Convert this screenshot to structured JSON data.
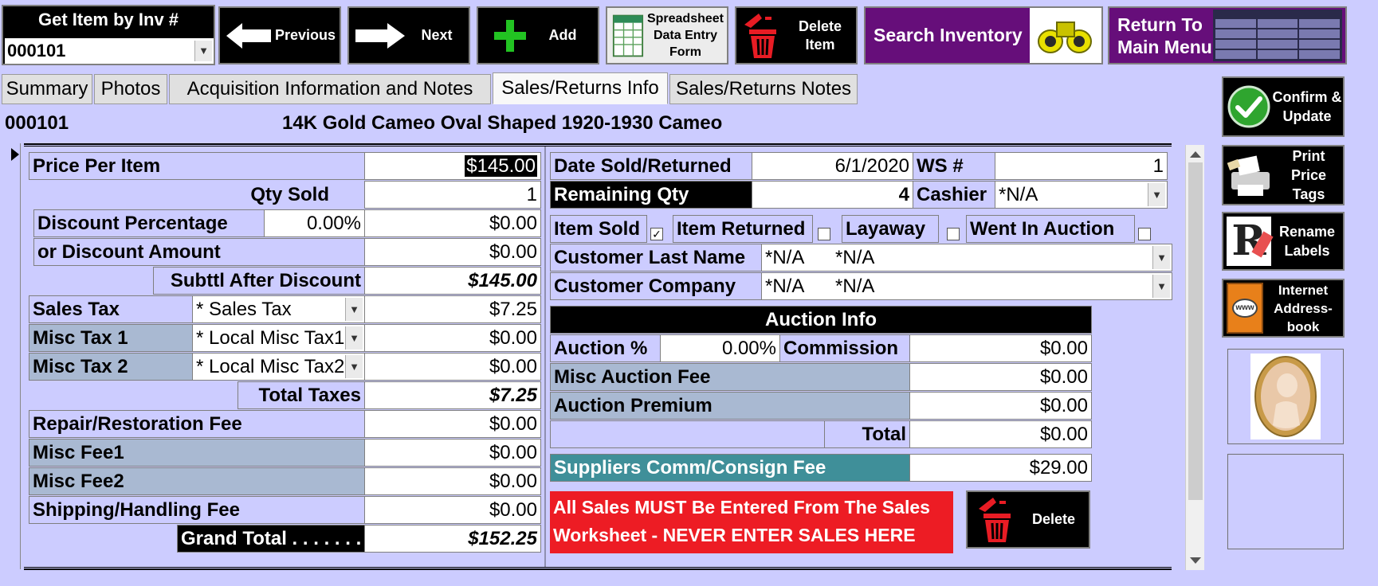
{
  "toolbar": {
    "get_item_label": "Get Item by Inv #",
    "inv_number": "000101",
    "previous": "Previous",
    "next": "Next",
    "add": "Add",
    "spreadsheet": "Spreadsheet Data Entry Form",
    "delete_item": "Delete Item",
    "search_inventory": "Search Inventory",
    "return_main": "Return To Main Menu"
  },
  "tabs": [
    {
      "label": "Summary"
    },
    {
      "label": "Photos"
    },
    {
      "label": "Acquisition Information and Notes"
    },
    {
      "label": "Sales/Returns Info",
      "active": true
    },
    {
      "label": "Sales/Returns Notes"
    }
  ],
  "header": {
    "inv_number": "000101",
    "item_title": "14K Gold Cameo Oval Shaped 1920-1930 Cameo"
  },
  "pricing": {
    "price_per_item_label": "Price Per Item",
    "price_per_item": "$145.00",
    "qty_sold_label": "Qty Sold",
    "qty_sold": "1",
    "discount_pct_label": "Discount Percentage",
    "discount_pct": "0.00%",
    "discount_pct_amount": "$0.00",
    "discount_amount_label": "or Discount Amount",
    "discount_amount": "$0.00",
    "subtotal_label": "Subttl After Discount",
    "subtotal": "$145.00",
    "sales_tax_label": "Sales Tax",
    "sales_tax_select": "* Sales Tax",
    "sales_tax": "$7.25",
    "misc_tax1_label": "Misc Tax 1",
    "misc_tax1_select": "* Local Misc Tax1",
    "misc_tax1": "$0.00",
    "misc_tax2_label": "Misc Tax 2",
    "misc_tax2_select": "* Local Misc Tax2",
    "misc_tax2": "$0.00",
    "total_taxes_label": "Total Taxes",
    "total_taxes": "$7.25",
    "repair_label": "Repair/Restoration Fee",
    "repair": "$0.00",
    "misc_fee1_label": "Misc Fee1",
    "misc_fee1": "$0.00",
    "misc_fee2_label": "Misc Fee2",
    "misc_fee2": "$0.00",
    "shipping_label": "Shipping/Handling Fee",
    "shipping": "$0.00",
    "grand_total_label": "Grand Total . . . . . . .",
    "grand_total": "$152.25"
  },
  "sale": {
    "date_label": "Date Sold/Returned",
    "date": "6/1/2020",
    "ws_label": "WS #",
    "ws": "1",
    "remaining_label": "Remaining Qty",
    "remaining": "4",
    "cashier_label": "Cashier",
    "cashier": "*N/A",
    "item_sold_label": "Item Sold",
    "item_returned_label": "Item Returned",
    "layaway_label": "Layaway",
    "auction_label": "Went In Auction",
    "check_mark": "✓",
    "customer_last_label": "Customer Last Name",
    "customer_last": "*N/A      *N/A",
    "customer_company_label": "Customer Company",
    "customer_company": "*N/A      *N/A"
  },
  "auction": {
    "header": "Auction Info",
    "pct_label": "Auction %",
    "pct": "0.00%",
    "commission_label": "Commission",
    "commission": "$0.00",
    "misc_fee_label": "Misc Auction Fee",
    "misc_fee": "$0.00",
    "premium_label": "Auction Premium",
    "premium": "$0.00",
    "total_label": "Total",
    "total": "$0.00"
  },
  "suppliers": {
    "label": "Suppliers Comm/Consign Fee",
    "value": "$29.00"
  },
  "warning": {
    "line1": "All Sales MUST Be Entered From The Sales",
    "line2": "Worksheet - NEVER ENTER SALES HERE"
  },
  "delete_label": "Delete",
  "side": {
    "confirm": "Confirm & Update",
    "print": "Print Price Tags",
    "rename": "Rename Labels",
    "address": "Internet Address-book"
  },
  "colors": {
    "background": "#ccccff",
    "purple": "#660e7a",
    "warning_red": "#ed1c24",
    "teal": "#3f8f99",
    "label_blue": "#a9b9d2"
  }
}
